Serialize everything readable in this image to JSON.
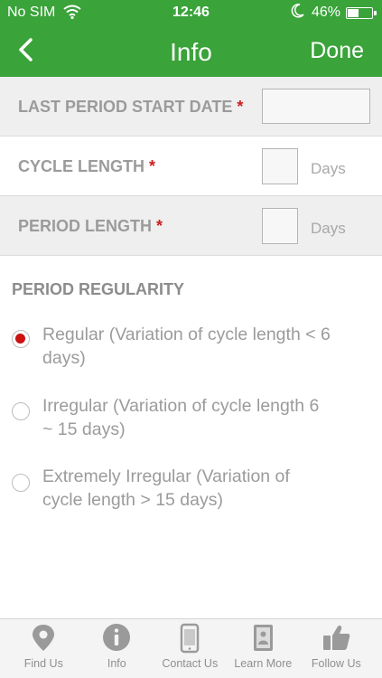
{
  "status_bar": {
    "carrier": "No SIM",
    "time": "12:46",
    "battery_percent": "46%",
    "battery_level": 0.46
  },
  "nav": {
    "title": "Info",
    "done_label": "Done"
  },
  "fields": [
    {
      "label": "LAST PERIOD START DATE",
      "required": "*",
      "value": "",
      "unit": ""
    },
    {
      "label": "CYCLE LENGTH",
      "required": "*",
      "value": "",
      "unit": "Days"
    },
    {
      "label": "PERIOD LENGTH",
      "required": "*",
      "value": "",
      "unit": "Days"
    }
  ],
  "regularity": {
    "title": "PERIOD REGULARITY",
    "options": [
      {
        "label": "Regular (Variation of cycle length < 6 days)",
        "selected": true
      },
      {
        "label": "Irregular (Variation of cycle length 6 ~ 15 days)",
        "selected": false
      },
      {
        "label": "Extremely Irregular (Variation of cycle length > 15 days)",
        "selected": false
      }
    ]
  },
  "tabs": [
    {
      "label": "Find Us",
      "icon": "map-pin-icon"
    },
    {
      "label": "Info",
      "icon": "info-icon"
    },
    {
      "label": "Contact Us",
      "icon": "phone-icon"
    },
    {
      "label": "Learn More",
      "icon": "book-icon"
    },
    {
      "label": "Follow Us",
      "icon": "thumbs-up-icon"
    }
  ],
  "colors": {
    "accent": "#3aa33a",
    "required": "#cc1f1f",
    "radio_selected": "#cc1111",
    "label_gray": "#9b9b9b"
  }
}
